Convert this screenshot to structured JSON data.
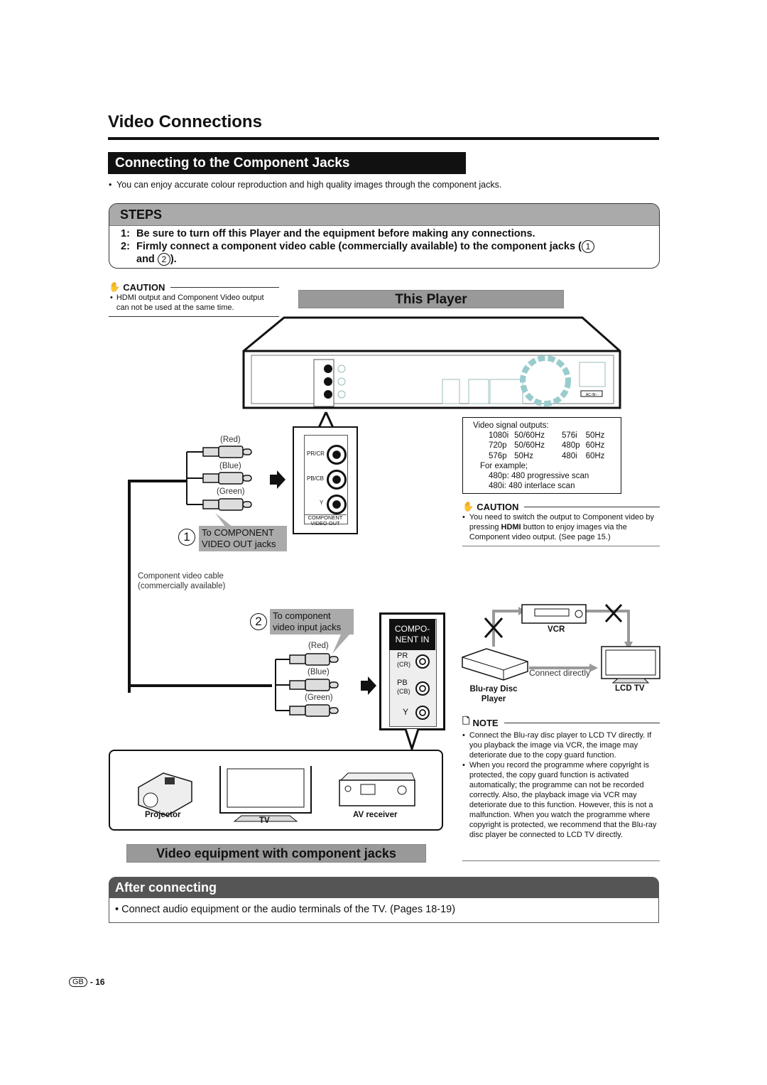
{
  "page_title": "Video Connections",
  "section_title": "Connecting to the Component Jacks",
  "intro": "You can enjoy accurate colour reproduction and high quality images through the component jacks.",
  "steps": {
    "heading": "STEPS",
    "items": [
      {
        "num": "1:",
        "text": "Be sure to turn off this Player and the equipment before making any connections."
      },
      {
        "num": "2:",
        "text": "Firmly connect a component video cable (commercially available) to the component jacks (",
        "mark1": "1",
        "and": "and",
        "mark2": "2",
        "end": ")."
      }
    ]
  },
  "caution_left": {
    "heading": "CAUTION",
    "text": "HDMI output and Component Video output can not be used at the same time."
  },
  "this_player": "This Player",
  "player_panel": {
    "jack_pr": "PR/CR",
    "jack_pb": "PB/CB",
    "jack_y": "Y",
    "panel_label_1": "COMPONENT",
    "panel_label_2": "VIDEO OUT",
    "ac_label": "AC IN~"
  },
  "cable_colors": [
    "(Red)",
    "(Blue)",
    "(Green)"
  ],
  "callout1": {
    "num": "1",
    "text_1": "To COMPONENT",
    "text_2": "VIDEO OUT jacks"
  },
  "cable_label": {
    "line1": "Component video cable",
    "line2": "(commercially available)"
  },
  "signal_box": {
    "heading": "Video signal outputs:",
    "rows": [
      [
        "1080i",
        "50/60Hz",
        "576i",
        "50Hz"
      ],
      [
        "720p",
        "50/60Hz",
        "480p",
        "60Hz"
      ],
      [
        "576p",
        "50Hz",
        "480i",
        "60Hz"
      ]
    ],
    "example_heading": "For example;",
    "examples": [
      "480p: 480 progressive scan",
      "480i:  480 interlace scan"
    ]
  },
  "caution_right": {
    "heading": "CAUTION",
    "text_before": "You need to switch the output to Component video by pressing ",
    "bold": "HDMI",
    "text_after": " button to enjoy images via the Component video output. (See page 15.)"
  },
  "callout2": {
    "num": "2",
    "text_1": "To component",
    "text_2": "video input jacks"
  },
  "component_in": {
    "header_1": "COMPO-",
    "header_2": "NENT IN",
    "pr": "PR",
    "cr": "(CR)",
    "pb": "PB",
    "cb": "(CB)",
    "y": "Y"
  },
  "equipment": {
    "projector": "Projector",
    "tv": "TV",
    "av_receiver": "AV receiver",
    "caption": "Video equipment with component jacks"
  },
  "vcr_diagram": {
    "vcr": "VCR",
    "bluray_1": "Blu-ray Disc",
    "bluray_2": "Player",
    "lcd_tv": "LCD TV",
    "connect_directly": "Connect directly"
  },
  "note": {
    "heading": "NOTE",
    "items": [
      "Connect the Blu-ray disc player to LCD TV directly. If you playback the image via VCR, the image may deteriorate due to the copy guard function.",
      "When you record the programme where copyright is protected, the copy guard function is activated automatically; the programme can not be recorded correctly. Also, the playback image via VCR may deteriorate due to this function. However, this is not a malfunction. When you watch the programme where copyright is protected, we recommend that the Blu-ray disc player be connected to LCD TV directly."
    ]
  },
  "after_connecting": {
    "heading": "After connecting",
    "text": "Connect audio equipment or the audio terminals of the TV. (Pages 18-19)"
  },
  "footer": {
    "region": "GB",
    "page": "- 16"
  }
}
